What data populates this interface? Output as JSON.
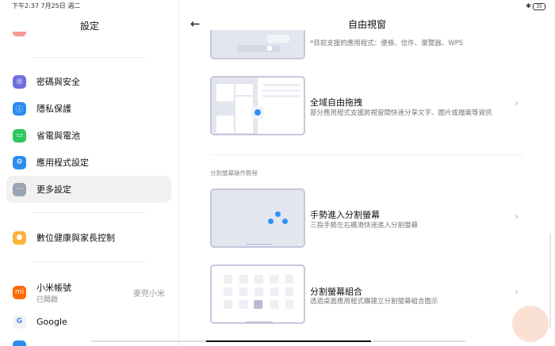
{
  "status_bar": {
    "time": "下午2:37 7月25日 週二",
    "battery": "35"
  },
  "sidebar": {
    "title": "設定",
    "items": [
      {
        "label": "密碼與安全",
        "color": "#6f6fe0"
      },
      {
        "label": "隱私保護",
        "color": "#2b8cf0"
      },
      {
        "label": "省電與電池",
        "color": "#2ec65e"
      },
      {
        "label": "應用程式設定",
        "color": "#2b8cf0"
      },
      {
        "label": "更多設定",
        "color": "#9aa3b2",
        "selected": true
      },
      {
        "label": "數位健康與家長控制",
        "color": "#fbb43a"
      },
      {
        "label": "小米帳號",
        "sub": "已開啟",
        "value": "麥兜小米",
        "color": "#ff6a00"
      },
      {
        "label": "Google",
        "color": "#f3f3f3"
      }
    ]
  },
  "main": {
    "title": "自由視窗",
    "card1": {
      "desc": "*目前支援的應用程式：便條、信件、瀏覽器、WPS"
    },
    "card2": {
      "title": "全域自由拖拽",
      "desc": "部分應用程式支援跨視窗間快速分享文字、圖片或檔案等資訊"
    },
    "section": "分割螢幕操作教程",
    "card3": {
      "title": "手勢進入分割螢幕",
      "desc": "三指手勢左右橫滑快速進入分割螢幕"
    },
    "card4": {
      "title": "分割螢幕組合",
      "desc": "透過桌面應用程式欄建立分割螢幕組合圖示"
    }
  }
}
